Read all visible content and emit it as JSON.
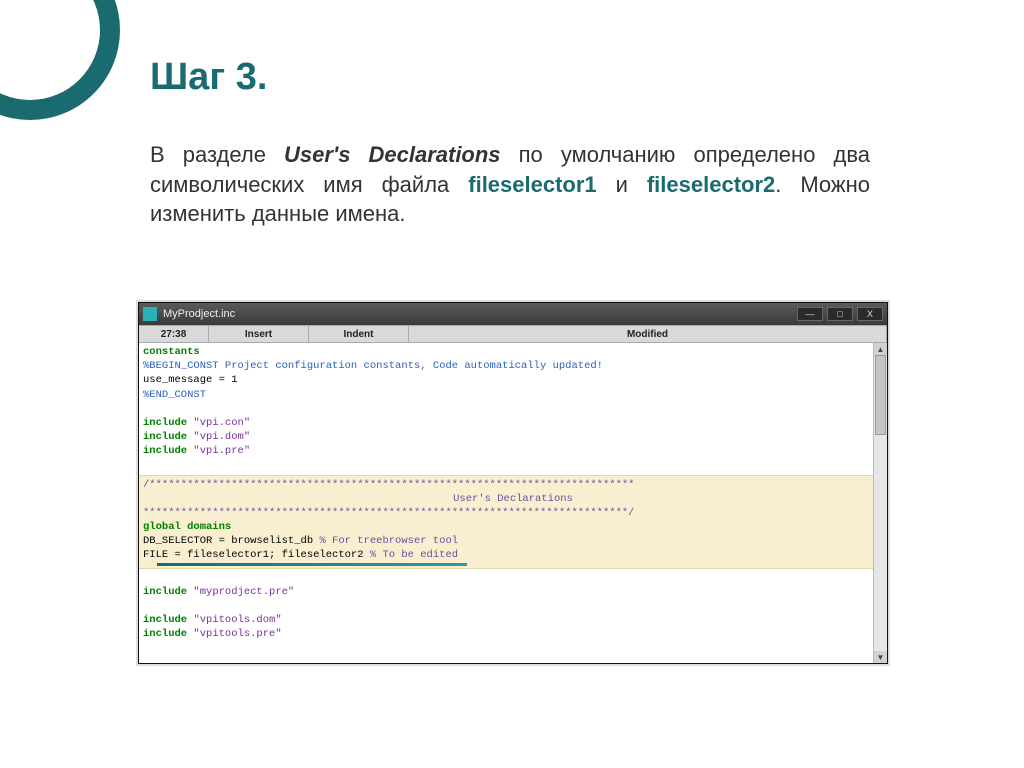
{
  "slide": {
    "title": "Шаг 3.",
    "para_pre": "В разделе ",
    "para_em": "User's Declarations",
    "para_mid1": " по умолчанию определено два символических имя файла ",
    "kw1": "fileselector1",
    "para_and": " и ",
    "kw2": "fileselector2",
    "para_tail": ". Можно изменить данные имена."
  },
  "window": {
    "title": "MyProdject.inc",
    "buttons": {
      "min": "—",
      "max": "□",
      "close": "X"
    },
    "status": {
      "pos": "27:38",
      "insert": "Insert",
      "indent": "Indent",
      "modified": "Modified"
    }
  },
  "code": {
    "l1": "constants",
    "l2": "%BEGIN_CONST Project configuration constants, Code automatically updated!",
    "l3": "  use_message = 1",
    "l4": "%END_CONST",
    "inc1a": "include ",
    "inc1b": "\"vpi.con\"",
    "inc2a": "include ",
    "inc2b": "\"vpi.dom\"",
    "inc3a": "include ",
    "inc3b": "\"vpi.pre\"",
    "hdiv1": "/*****************************************************************************",
    "hlabel": "User's Declarations",
    "hdiv2": "*****************************************************************************/",
    "gdom": "global domains",
    "line_db_a": "  DB_SELECTOR = browselist_db   ",
    "line_db_b": "% For treebrowser tool",
    "line_file_a": "  FILE = fileselector1; fileselector2 ",
    "line_file_b": "% To be edited",
    "inc4a": "include ",
    "inc4b": "\"myprodject.pre\"",
    "inc5a": "include ",
    "inc5b": "\"vpitools.dom\"",
    "inc6a": "include ",
    "inc6b": "\"vpitools.pre\""
  }
}
